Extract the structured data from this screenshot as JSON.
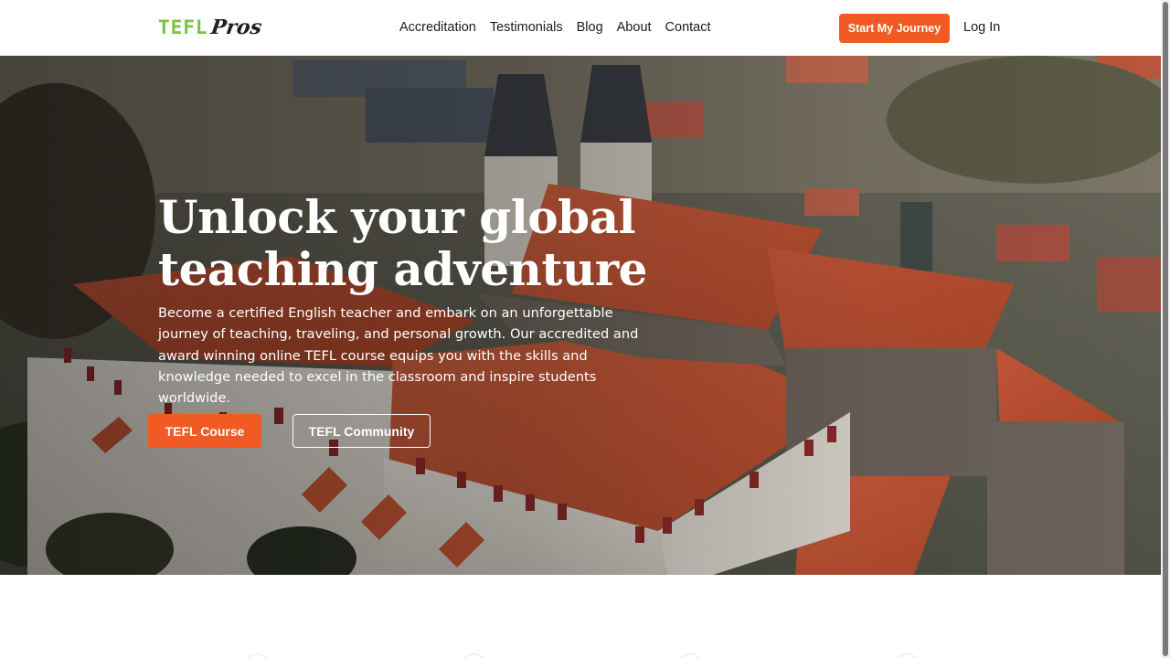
{
  "header": {
    "logo": {
      "part1": "TEFL",
      "part2": "Pros"
    },
    "nav": [
      {
        "label": "Accreditation"
      },
      {
        "label": "Testimonials"
      },
      {
        "label": "Blog"
      },
      {
        "label": "About"
      },
      {
        "label": "Contact"
      }
    ],
    "cta_label": "Start My Journey",
    "login_label": "Log In"
  },
  "hero": {
    "title": "Unlock your global teaching adventure",
    "subtitle": "Become a certified English teacher and embark on an unforgettable journey of teaching, traveling, and personal growth. Our accredited and award winning online TEFL course equips you with the skills and knowledge needed to excel in the classroom and inspire students worldwide.",
    "primary_button": "TEFL Course",
    "secondary_button": "TEFL Community"
  },
  "colors": {
    "accent": "#f15a22",
    "logo_green": "#7cc243",
    "text_dark": "#1c1c1c",
    "roof": "#c2532f"
  }
}
